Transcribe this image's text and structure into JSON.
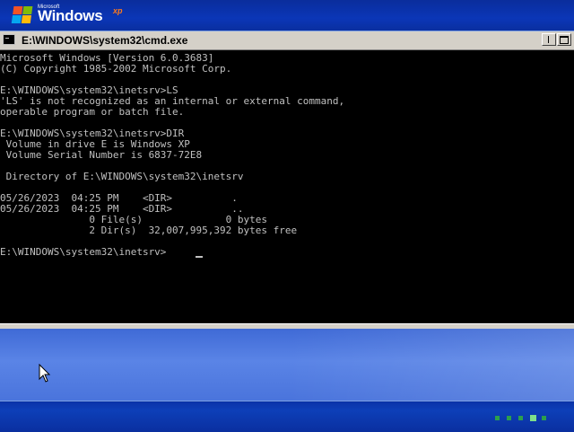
{
  "brand": {
    "microsoft": "Microsoft",
    "windows": "Windows",
    "xp": "xp"
  },
  "window": {
    "title": "E:\\WINDOWS\\system32\\cmd.exe",
    "icon": "console-icon",
    "controls": [
      "minimize",
      "maximize"
    ]
  },
  "console": {
    "lines": [
      "Microsoft Windows [Version 6.0.3683]",
      "(C) Copyright 1985-2002 Microsoft Corp.",
      "",
      "E:\\WINDOWS\\system32\\inetsrv>LS",
      "'LS' is not recognized as an internal or external command,",
      "operable program or batch file.",
      "",
      "E:\\WINDOWS\\system32\\inetsrv>DIR",
      " Volume in drive E is Windows XP",
      " Volume Serial Number is 6837-72E8",
      "",
      " Directory of E:\\WINDOWS\\system32\\inetsrv",
      "",
      "05/26/2023  04:25 PM    <DIR>          .",
      "05/26/2023  04:25 PM    <DIR>          ..",
      "               0 File(s)              0 bytes",
      "               2 Dir(s)  32,007,995,392 bytes free",
      "",
      "E:\\WINDOWS\\system32\\inetsrv>"
    ]
  },
  "colors": {
    "console_bg": "#000000",
    "console_text": "#c0c0c0",
    "desktop_blue": "#4a74dc",
    "progress_green": "#2c9f4c"
  },
  "loading": {
    "dots_total": 5,
    "active_index": 3
  },
  "icons": {
    "pointer": "mouse-pointer-icon",
    "logo": "windows-flag-icon"
  }
}
